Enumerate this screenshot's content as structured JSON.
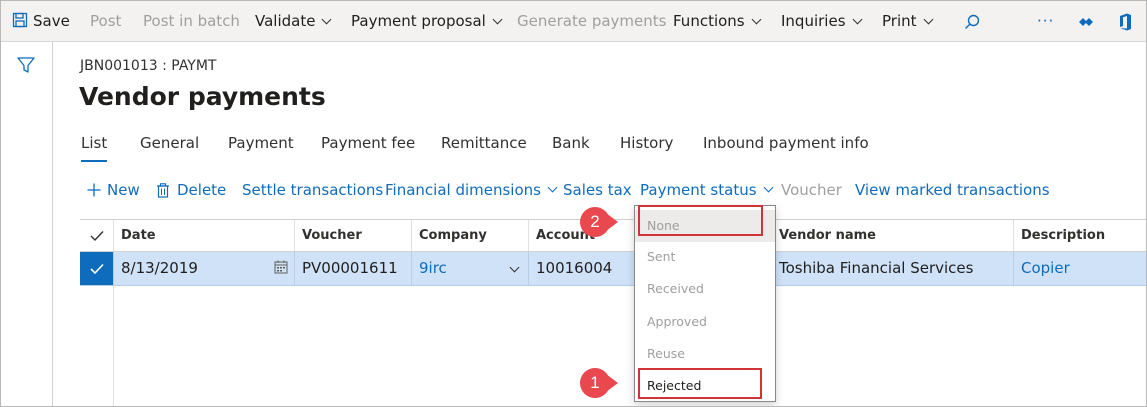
{
  "actionbar": {
    "save": "Save",
    "post": "Post",
    "post_in_batch": "Post in batch",
    "validate": "Validate",
    "payment_proposal": "Payment proposal",
    "generate_payments": "Generate payments",
    "functions": "Functions",
    "inquiries": "Inquiries",
    "print": "Print",
    "more": "···"
  },
  "header": {
    "breadcrumb": "JBN001013 : PAYMT",
    "title": "Vendor payments"
  },
  "tabs": [
    "List",
    "General",
    "Payment",
    "Payment fee",
    "Remittance",
    "Bank",
    "History",
    "Inbound payment info"
  ],
  "commands": {
    "new": "New",
    "delete": "Delete",
    "settle": "Settle transactions",
    "financial_dimensions": "Financial dimensions",
    "sales_tax": "Sales tax",
    "payment_status": "Payment status",
    "voucher": "Voucher",
    "view_marked": "View marked transactions"
  },
  "grid": {
    "columns": [
      "Date",
      "Voucher",
      "Company",
      "Account",
      "Vendor name",
      "Description"
    ],
    "row": {
      "date": "8/13/2019",
      "voucher": "PV00001611",
      "company": "9irc",
      "account": "10016004",
      "vendor_name": "Toshiba Financial Services",
      "description": "Copier"
    }
  },
  "payment_status_menu": {
    "options": [
      "None",
      "Sent",
      "Received",
      "Approved",
      "Reuse",
      "Rejected"
    ],
    "selected": "None"
  },
  "callouts": {
    "one": "1",
    "two": "2"
  },
  "colors": {
    "accent": "#0f6cbd",
    "callout": "#e8484e",
    "highlight": "#d13438",
    "row_selected": "#cfe2f8"
  }
}
